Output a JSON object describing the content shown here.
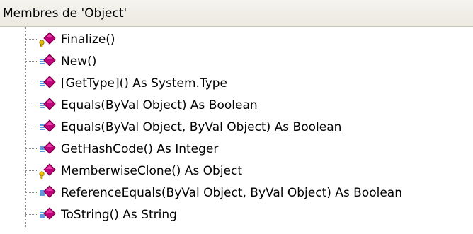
{
  "header": {
    "title_prefix": "M",
    "title_mnemonic": "e",
    "title_rest": "mbres de 'Object'"
  },
  "members": [
    {
      "label": "Finalize()",
      "icon": "protected-method-icon"
    },
    {
      "label": "New()",
      "icon": "public-method-icon"
    },
    {
      "label": "[GetType]() As System.Type",
      "icon": "public-method-icon"
    },
    {
      "label": "Equals(ByVal Object) As Boolean",
      "icon": "public-method-icon"
    },
    {
      "label": "Equals(ByVal Object, ByVal Object) As Boolean",
      "icon": "public-method-icon"
    },
    {
      "label": "GetHashCode() As Integer",
      "icon": "public-method-icon"
    },
    {
      "label": "MemberwiseClone() As Object",
      "icon": "protected-method-icon"
    },
    {
      "label": "ReferenceEquals(ByVal Object, ByVal Object) As Boolean",
      "icon": "public-method-icon"
    },
    {
      "label": "ToString() As String",
      "icon": "public-method-icon"
    }
  ],
  "colors": {
    "method_magenta": "#c0007a",
    "method_dark": "#6a0040",
    "method_light": "#ff66c4",
    "public_lines": "#3b7fd9",
    "protected_key": "#e8c000"
  }
}
